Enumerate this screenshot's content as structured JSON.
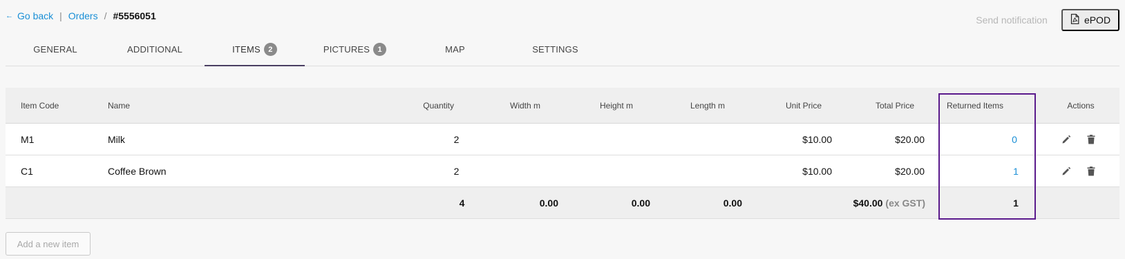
{
  "breadcrumb": {
    "back_label": "Go back",
    "sep1": "|",
    "orders_label": "Orders",
    "sep2": "/",
    "order_id": "#5556051"
  },
  "header_actions": {
    "send_notification": "Send notification",
    "epod": "ePOD"
  },
  "tabs": [
    {
      "label": "GENERAL"
    },
    {
      "label": "ADDITIONAL"
    },
    {
      "label": "ITEMS",
      "badge": "2",
      "active": true
    },
    {
      "label": "PICTURES",
      "badge": "1"
    },
    {
      "label": "MAP"
    },
    {
      "label": "SETTINGS"
    }
  ],
  "table": {
    "headers": {
      "item_code": "Item Code",
      "name": "Name",
      "quantity": "Quantity",
      "width": "Width m",
      "height": "Height m",
      "length": "Length m",
      "unit_price": "Unit Price",
      "total_price": "Total Price",
      "returned_items": "Returned Items",
      "actions": "Actions"
    },
    "rows": [
      {
        "item_code": "M1",
        "name": "Milk",
        "quantity": "2",
        "width": "",
        "height": "",
        "length": "",
        "unit_price": "$10.00",
        "total_price": "$20.00",
        "returned": "0"
      },
      {
        "item_code": "C1",
        "name": "Coffee Brown",
        "quantity": "2",
        "width": "",
        "height": "",
        "length": "",
        "unit_price": "$10.00",
        "total_price": "$20.00",
        "returned": "1"
      }
    ],
    "totals": {
      "quantity": "4",
      "width": "0.00",
      "height": "0.00",
      "length": "0.00",
      "total_price": "$40.00",
      "gst_note": "(ex GST)",
      "returned": "1"
    }
  },
  "add_item_label": "Add a new item",
  "icons": {
    "back": "arrow-left-icon",
    "pdf": "pdf-file-icon",
    "edit": "pencil-icon",
    "delete": "trash-icon"
  },
  "colors": {
    "link": "#1a8fd6",
    "active_tab": "#4b3f63",
    "highlight": "#5a1a8c",
    "badge": "#8a8a8a"
  }
}
